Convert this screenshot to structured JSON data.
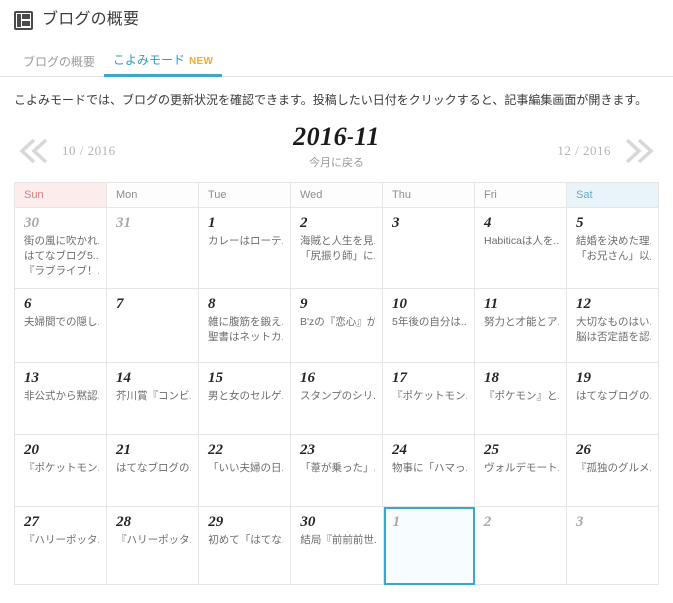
{
  "header": {
    "icon": "dashboard-layout-icon",
    "title": "ブログの概要"
  },
  "tabs": [
    {
      "label": "ブログの概要",
      "active": false,
      "badge": ""
    },
    {
      "label": "こよみモード",
      "active": true,
      "badge": "NEW"
    }
  ],
  "description": "こよみモードでは、ブログの更新状況を確認できます。投稿したい日付をクリックすると、記事編集画面が開きます。",
  "month_nav": {
    "prev_label": "10 / 2016",
    "next_label": "12 / 2016",
    "current_year": "2016",
    "current_separator": "-",
    "current_month": "11",
    "back_to_this_month": "今月に戻る",
    "prev_icon": "chevron-double-left-icon",
    "next_icon": "chevron-double-right-icon"
  },
  "calendar": {
    "weekdays": [
      "Sun",
      "Mon",
      "Tue",
      "Wed",
      "Thu",
      "Fri",
      "Sat"
    ],
    "colors": {
      "sunday_bg": "#fcecec",
      "sunday_text": "#d98080",
      "saturday_bg": "#e9f4f9",
      "saturday_text": "#6aa9c6",
      "selected_border": "#3ba7cb",
      "accent": "#3ba7cb",
      "badge": "#f0ad2e"
    },
    "rows": [
      [
        {
          "day": "30",
          "other_month": true,
          "selected": false,
          "entries": [
            "街の風に吹かれ...",
            "はてなブログ5...",
            "『ラブライブ！..."
          ]
        },
        {
          "day": "31",
          "other_month": true,
          "selected": false,
          "entries": []
        },
        {
          "day": "1",
          "other_month": false,
          "selected": false,
          "entries": [
            "カレーはローテ..."
          ]
        },
        {
          "day": "2",
          "other_month": false,
          "selected": false,
          "entries": [
            "海賊と人生を見...",
            "「尻振り師」に..."
          ]
        },
        {
          "day": "3",
          "other_month": false,
          "selected": false,
          "entries": []
        },
        {
          "day": "4",
          "other_month": false,
          "selected": false,
          "entries": [
            "Habiticaは人を..."
          ]
        },
        {
          "day": "5",
          "other_month": false,
          "selected": false,
          "entries": [
            "結婚を決めた理...",
            "「お兄さん」以上「..."
          ]
        }
      ],
      [
        {
          "day": "6",
          "other_month": false,
          "selected": false,
          "entries": [
            "夫婦間での隠し..."
          ]
        },
        {
          "day": "7",
          "other_month": false,
          "selected": false,
          "entries": []
        },
        {
          "day": "8",
          "other_month": false,
          "selected": false,
          "entries": [
            "雑に腹筋を鍛え...",
            "聖書はネットカ..."
          ]
        },
        {
          "day": "9",
          "other_month": false,
          "selected": false,
          "entries": [
            "B'zの『恋心』が..."
          ]
        },
        {
          "day": "10",
          "other_month": false,
          "selected": false,
          "entries": [
            "5年後の自分は..."
          ]
        },
        {
          "day": "11",
          "other_month": false,
          "selected": false,
          "entries": [
            "努力と才能とア..."
          ]
        },
        {
          "day": "12",
          "other_month": false,
          "selected": false,
          "entries": [
            "大切なものはい...",
            "脳は否定語を認..."
          ]
        }
      ],
      [
        {
          "day": "13",
          "other_month": false,
          "selected": false,
          "entries": [
            "非公式から黙認..."
          ]
        },
        {
          "day": "14",
          "other_month": false,
          "selected": false,
          "entries": [
            "芥川賞『コンビ..."
          ]
        },
        {
          "day": "15",
          "other_month": false,
          "selected": false,
          "entries": [
            "男と女のセルゲ..."
          ]
        },
        {
          "day": "16",
          "other_month": false,
          "selected": false,
          "entries": [
            "スタンプのシリ..."
          ]
        },
        {
          "day": "17",
          "other_month": false,
          "selected": false,
          "entries": [
            "『ポケットモン..."
          ]
        },
        {
          "day": "18",
          "other_month": false,
          "selected": false,
          "entries": [
            "『ポケモン』と..."
          ]
        },
        {
          "day": "19",
          "other_month": false,
          "selected": false,
          "entries": [
            "はてなブログの..."
          ]
        }
      ],
      [
        {
          "day": "20",
          "other_month": false,
          "selected": false,
          "entries": [
            "『ポケットモン..."
          ]
        },
        {
          "day": "21",
          "other_month": false,
          "selected": false,
          "entries": [
            "はてなブログの..."
          ]
        },
        {
          "day": "22",
          "other_month": false,
          "selected": false,
          "entries": [
            "「いい夫婦の日..."
          ]
        },
        {
          "day": "23",
          "other_month": false,
          "selected": false,
          "entries": [
            "「葦が乗った」..."
          ]
        },
        {
          "day": "24",
          "other_month": false,
          "selected": false,
          "entries": [
            "物事に「ハマっ..."
          ]
        },
        {
          "day": "25",
          "other_month": false,
          "selected": false,
          "entries": [
            "ヴォルデモート..."
          ]
        },
        {
          "day": "26",
          "other_month": false,
          "selected": false,
          "entries": [
            "『孤独のグルメ..."
          ]
        }
      ],
      [
        {
          "day": "27",
          "other_month": false,
          "selected": false,
          "entries": [
            "『ハリーポッタ..."
          ]
        },
        {
          "day": "28",
          "other_month": false,
          "selected": false,
          "entries": [
            "『ハリーポッタ..."
          ]
        },
        {
          "day": "29",
          "other_month": false,
          "selected": false,
          "entries": [
            "初めて「はてな..."
          ]
        },
        {
          "day": "30",
          "other_month": false,
          "selected": false,
          "entries": [
            "結局『前前前世..."
          ]
        },
        {
          "day": "1",
          "other_month": true,
          "selected": true,
          "entries": []
        },
        {
          "day": "2",
          "other_month": true,
          "selected": false,
          "entries": []
        },
        {
          "day": "3",
          "other_month": true,
          "selected": false,
          "entries": []
        }
      ]
    ]
  }
}
